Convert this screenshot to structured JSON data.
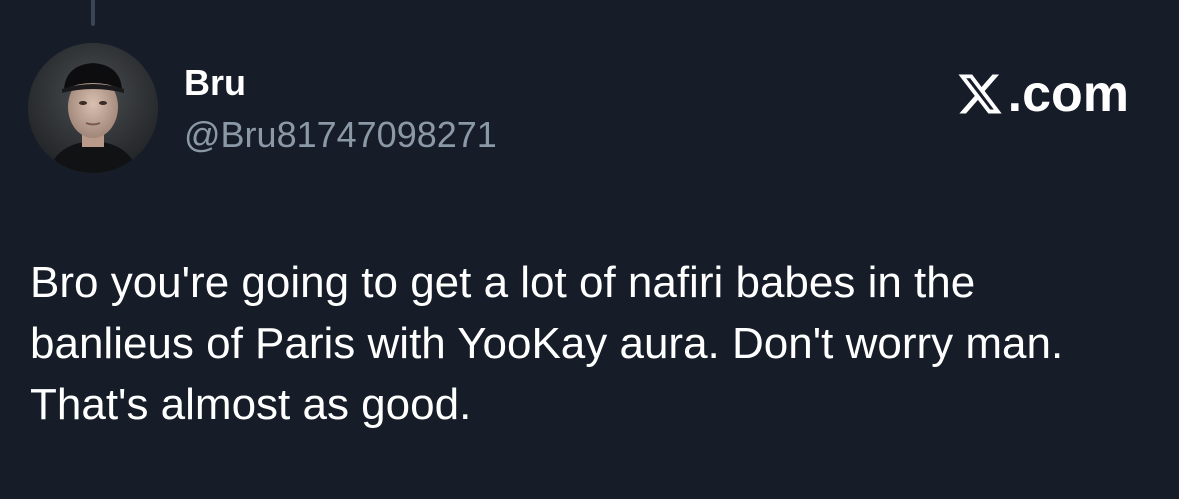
{
  "tweet": {
    "author": {
      "display_name": "Bru",
      "handle": "@Bru81747098271"
    },
    "brand_text": ".com",
    "brand_icon": "x-logo-icon",
    "text": "Bro you're going to get a lot of nafiri babes in the banlieus of Paris with YooKay aura. Don't worry man. That's almost as good."
  },
  "colors": {
    "background": "#161d28",
    "primary_text": "#ffffff",
    "secondary_text": "#8b98a5",
    "thread_line": "#3a4452"
  }
}
